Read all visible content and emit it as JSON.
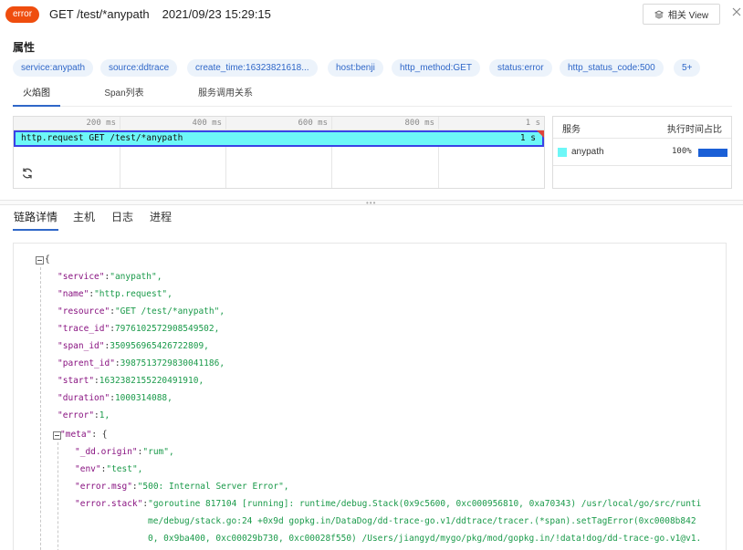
{
  "header": {
    "status_badge": "error",
    "title": "GET /test/*anypath",
    "timestamp": "2021/09/23 15:29:15",
    "view_button": "相关 View"
  },
  "attributes": {
    "heading": "属性",
    "tags": [
      "service:anypath",
      "source:ddtrace",
      "create_time:16323821618...",
      "host:benji",
      "http_method:GET",
      "status:error",
      "http_status_code:500",
      "5+"
    ]
  },
  "top_tabs": [
    "火焰图",
    "Span列表",
    "服务调用关系"
  ],
  "flame_graph": {
    "ticks": [
      "200 ms",
      "400 ms",
      "600 ms",
      "800 ms",
      "1 s"
    ],
    "span_label": "http.request GET /test/*anypath",
    "span_duration": "1 s",
    "span_color": "#6df7f7"
  },
  "service_panel": {
    "col_service": "服务",
    "col_ratio": "执行时间占比",
    "rows": [
      {
        "name": "anypath",
        "percent": "100%",
        "ratio": 1.0
      }
    ]
  },
  "detail_tabs": [
    "链路详情",
    "主机",
    "日志",
    "进程"
  ],
  "json_view": {
    "open_brace": "{",
    "fields": [
      {
        "key": "\"service\"",
        "value": "\"anypath\","
      },
      {
        "key": "\"name\"",
        "value": "\"http.request\","
      },
      {
        "key": "\"resource\"",
        "value": "\"GET /test/*anypath\","
      },
      {
        "key": "\"trace_id\"",
        "value": "7976102572908549502,"
      },
      {
        "key": "\"span_id\"",
        "value": "350956965426722809,"
      },
      {
        "key": "\"parent_id\"",
        "value": "3987513729830041186,"
      },
      {
        "key": "\"start\"",
        "value": "1632382155220491910,"
      },
      {
        "key": "\"duration\"",
        "value": "1000314088,"
      },
      {
        "key": "\"error\"",
        "value": "1,"
      }
    ],
    "meta_key": "\"meta\"",
    "meta_open": "{",
    "meta_fields": [
      {
        "key": "\"_dd.origin\"",
        "value": "\"rum\","
      },
      {
        "key": "\"env\"",
        "value": "\"test\","
      },
      {
        "key": "\"error.msg\"",
        "value": "\"500: Internal Server Error\","
      },
      {
        "key": "\"error.stack\"",
        "value": "\"goroutine 817104 [running]: runtime/debug.Stack(0x9c5600, 0xc000956810, 0xa70343) /usr/local/go/src/runti"
      }
    ],
    "stack_cont": [
      "me/debug/stack.go:24 +0x9d gopkg.in/DataDog/dd-trace-go.v1/ddtrace/tracer.(*span).setTagError(0xc0008b842",
      "0, 0x9ba400, 0xc00029b730, 0xc00028f550) /Users/jiangyd/mygo/pkg/mod/gopkg.in/!data!dog/dd-trace-go.v1@v1."
    ]
  }
}
